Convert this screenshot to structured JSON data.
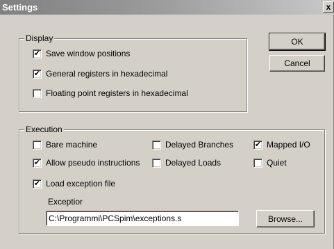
{
  "window": {
    "title": "Settings",
    "close_glyph": "x"
  },
  "display": {
    "label": "Display",
    "options": [
      {
        "label": "Save window positions",
        "checked": true
      },
      {
        "label": "General registers in hexadecimal",
        "checked": true
      },
      {
        "label": "Floating point registers in hexadecimal",
        "checked": false
      }
    ]
  },
  "buttons": {
    "ok": "OK",
    "cancel": "Cancel",
    "browse": "Browse..."
  },
  "execution": {
    "label": "Execution",
    "options": {
      "bare_machine": {
        "label": "Bare machine",
        "checked": false
      },
      "delayed_branches": {
        "label": "Delayed Branches",
        "checked": false
      },
      "mapped_io": {
        "label": "Mapped I/O",
        "checked": true
      },
      "allow_pseudo": {
        "label": "Allow pseudo instructions",
        "checked": true
      },
      "delayed_loads": {
        "label": "Delayed Loads",
        "checked": false
      },
      "quiet": {
        "label": "Quiet",
        "checked": false
      },
      "load_exception": {
        "label": "Load exception file",
        "checked": true
      }
    },
    "exception_label": "Exceptior",
    "exception_path": "C:\\Programmi\\PCSpim\\exceptions.s"
  },
  "check_glyph": "✔"
}
